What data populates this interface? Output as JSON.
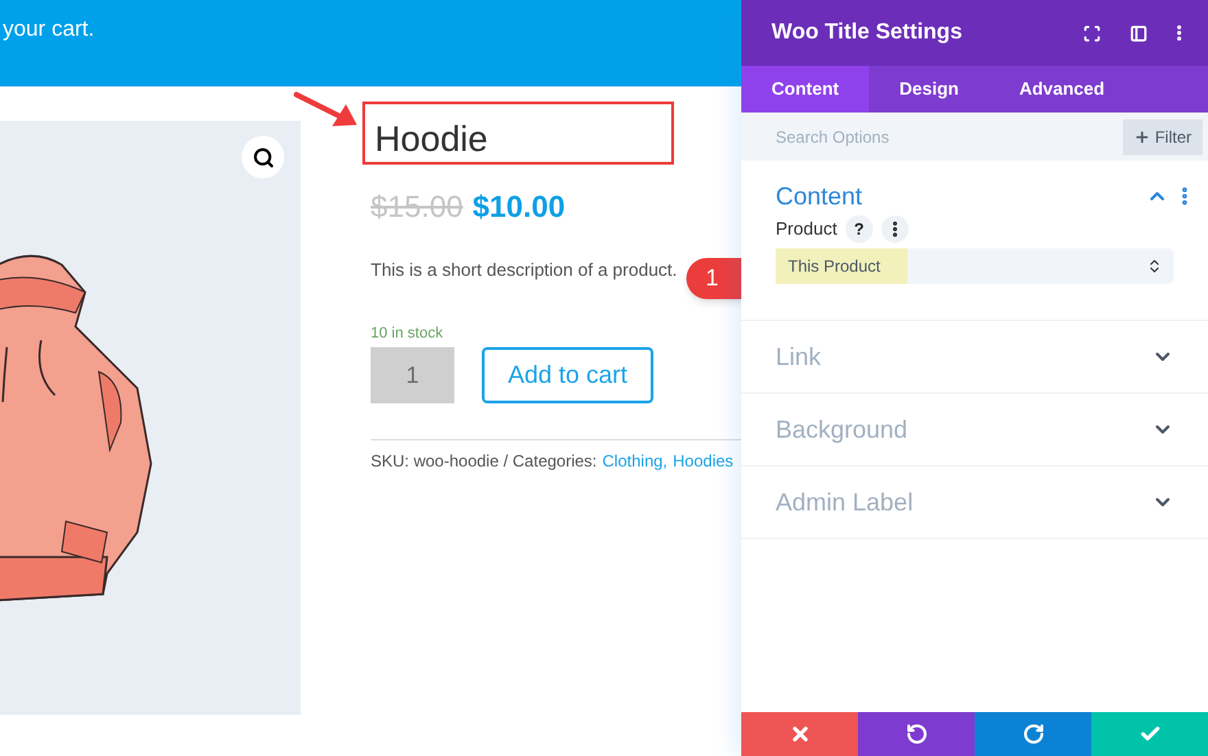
{
  "banner": {
    "text": "your cart."
  },
  "product": {
    "title": "Hoodie",
    "old_price": "$15.00",
    "price": "$10.00",
    "description": "This is a short description of a product.",
    "stock": "10 in stock",
    "quantity": "1",
    "add_button": "Add to cart",
    "sku_text": "SKU: woo-hoodie / Categories:",
    "categories": [
      "Clothing,",
      "Hoodies"
    ]
  },
  "annotation": {
    "callout": "1"
  },
  "panel": {
    "title": "Woo Title Settings",
    "tabs": [
      {
        "label": "Content",
        "selected": true
      },
      {
        "label": "Design",
        "selected": false
      },
      {
        "label": "Advanced",
        "selected": false
      }
    ],
    "search": {
      "placeholder": "Search Options"
    },
    "filter_button": "Filter",
    "sections": [
      {
        "title": "Content",
        "expanded": true,
        "fields": [
          {
            "label": "Product",
            "help": "?",
            "value": "This Product"
          }
        ]
      },
      {
        "title": "Link",
        "expanded": false
      },
      {
        "title": "Background",
        "expanded": false
      },
      {
        "title": "Admin Label",
        "expanded": false
      }
    ]
  }
}
